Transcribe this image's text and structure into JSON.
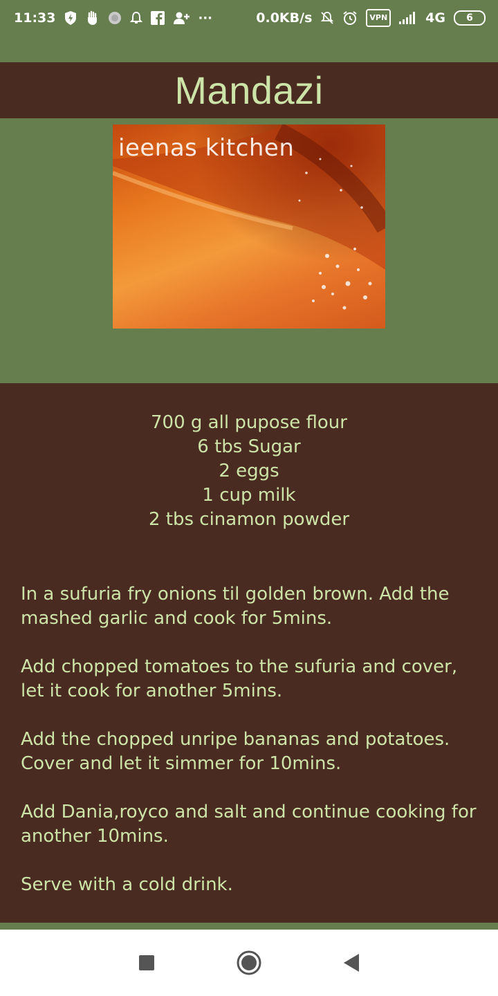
{
  "status_bar": {
    "time": "11:33",
    "network_speed": "0.0KB/s",
    "vpn": "VPN",
    "network_type": "4G",
    "battery": "6",
    "more": "···",
    "icons": [
      "lightning-shield-icon",
      "hand-icon",
      "circle-icon",
      "bell-icon",
      "facebook-icon",
      "add-user-icon",
      "more-icon",
      "mute-icon",
      "alarm-icon",
      "vpn-icon",
      "signal-icon",
      "battery-icon"
    ]
  },
  "recipe": {
    "title": "Mandazi",
    "image_watermark": "ieenas kitchen",
    "ingredients": [
      "700 g all pupose flour",
      "6 tbs Sugar",
      "2 eggs",
      "1 cup milk",
      "2 tbs cinamon powder"
    ],
    "steps": [
      "In a sufuria fry onions til golden brown. Add the mashed garlic and cook for 5mins.",
      "Add chopped tomatoes to the sufuria and cover, let it cook for another 5mins.",
      "Add the chopped unripe bananas and potatoes. Cover and let it simmer for 10mins.",
      "Add Dania,royco and salt and continue cooking for another 10mins.",
      "Serve with a cold drink."
    ]
  },
  "nav_bar": {
    "buttons": [
      "recent-apps-button",
      "home-button",
      "back-button"
    ]
  },
  "colors": {
    "page_background": "#667e4e",
    "panel_background": "#4a2b21",
    "text": "#cde4a8"
  }
}
